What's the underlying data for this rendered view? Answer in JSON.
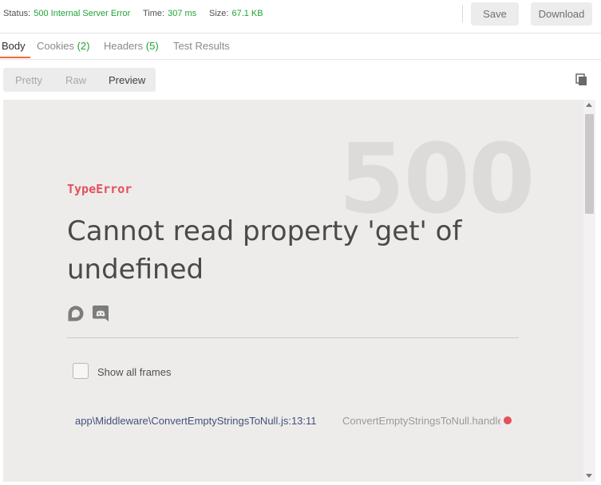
{
  "status": {
    "status_label": "Status:",
    "status_value": "500 Internal Server Error",
    "time_label": "Time:",
    "time_value": "307 ms",
    "size_label": "Size:",
    "size_value": "67.1 KB",
    "status_color": "#21a336"
  },
  "actions": {
    "save_label": "Save",
    "download_label": "Download"
  },
  "tabs": [
    {
      "label": "Body",
      "count": ""
    },
    {
      "label": "Cookies",
      "count": "(2)"
    },
    {
      "label": "Headers",
      "count": "(5)"
    },
    {
      "label": "Test Results",
      "count": ""
    }
  ],
  "view_modes": {
    "pretty": "Pretty",
    "raw": "Raw",
    "preview": "Preview",
    "selected": "Preview"
  },
  "preview": {
    "status_code": "500",
    "error_type": "TypeError",
    "error_message": "Cannot read property 'get' of undefined",
    "show_all_frames_label": "Show all frames",
    "frame_file": "app\\Middleware\\ConvertEmptyStringsToNull.js:13:11",
    "frame_function": "ConvertEmptyStringsToNull.handle",
    "error_color": "#e3505c",
    "icons": [
      "chat-bubble-icon",
      "discord-icon"
    ]
  }
}
